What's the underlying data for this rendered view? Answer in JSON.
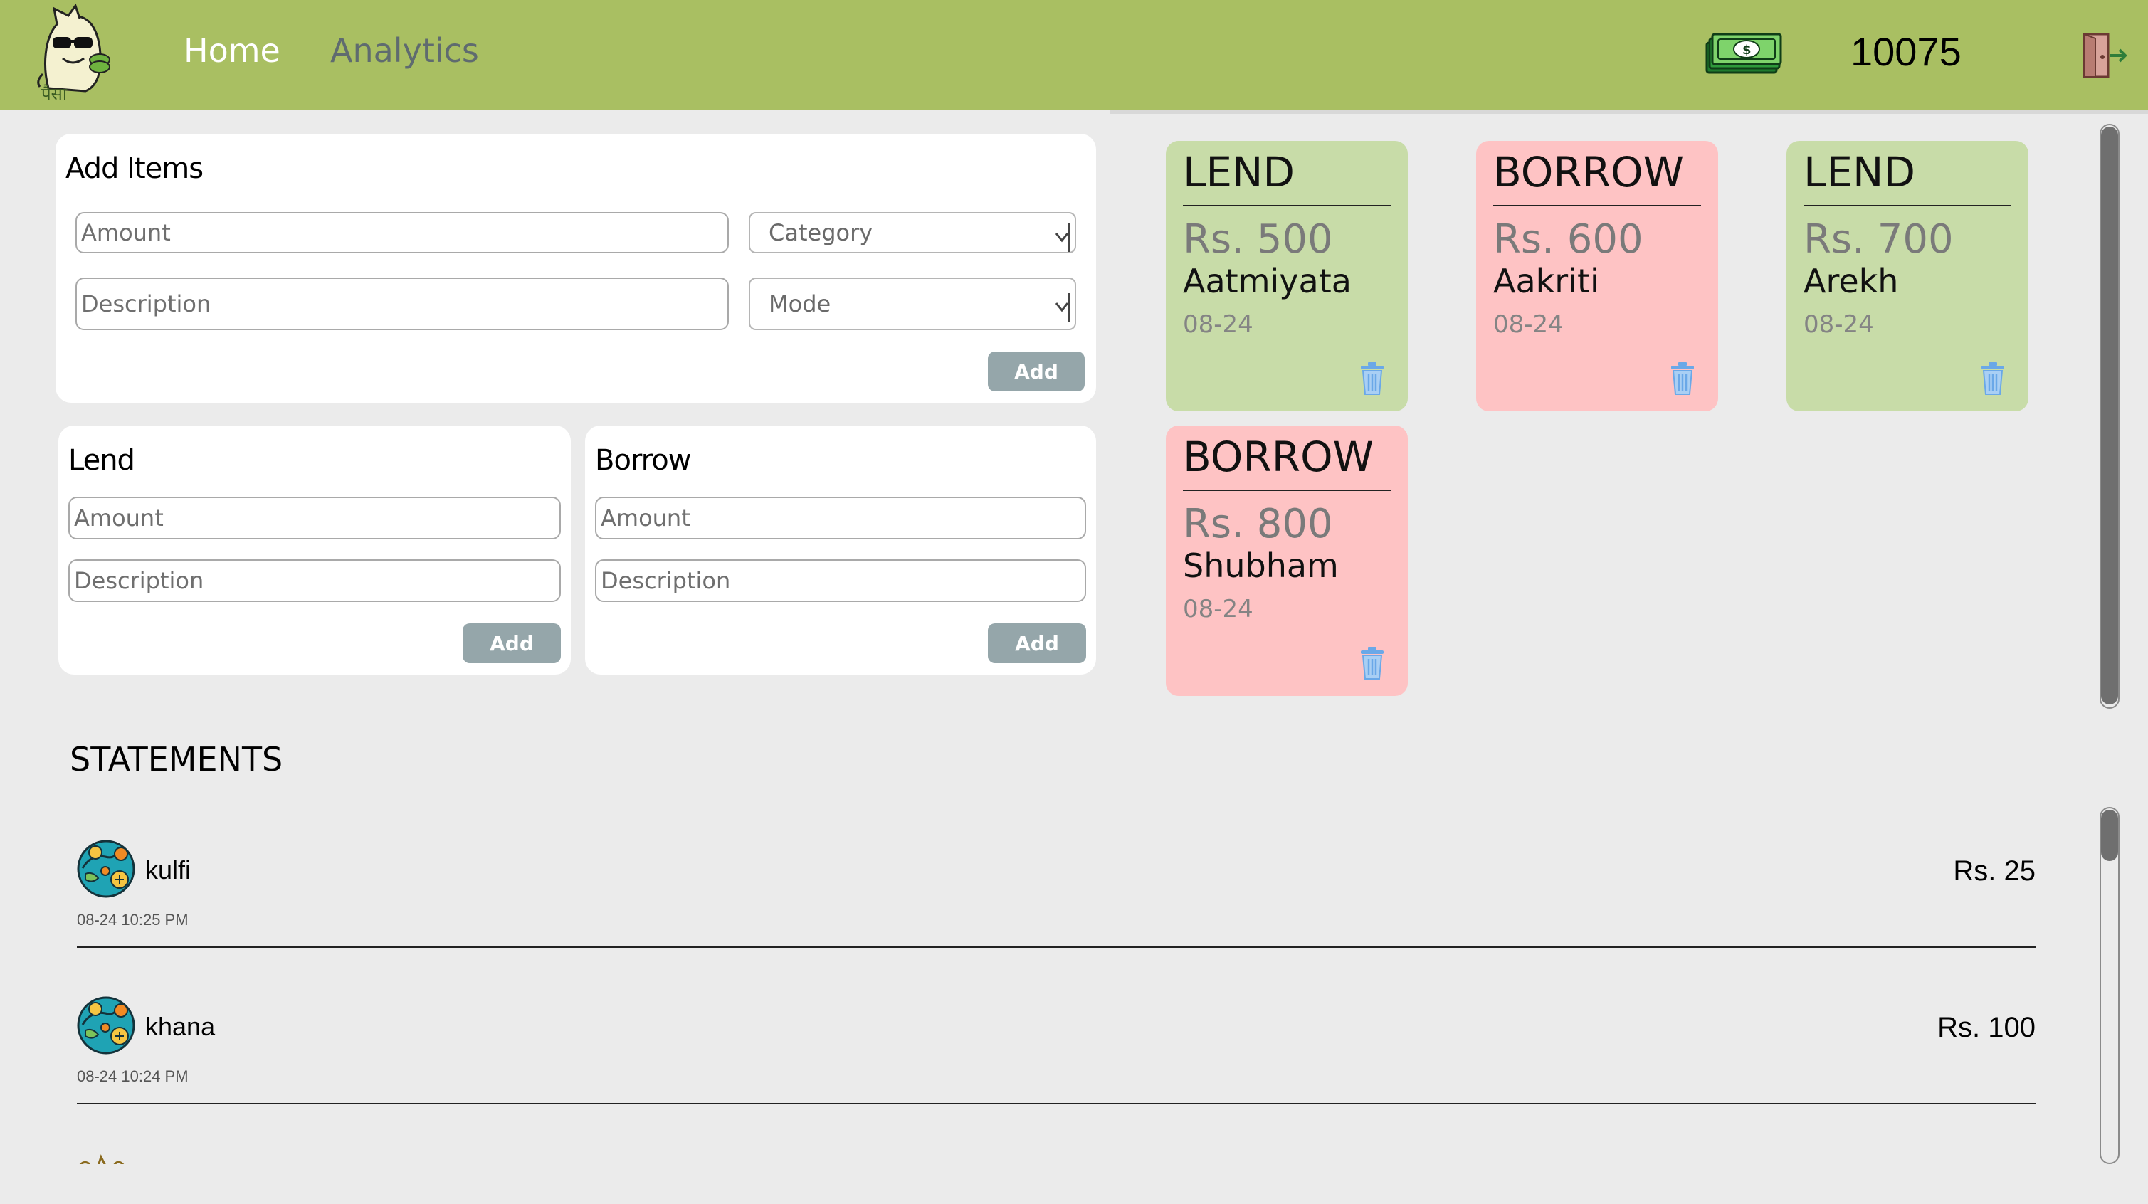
{
  "nav": {
    "home": "Home",
    "analytics": "Analytics",
    "logo_icon": "mascot-logo-icon",
    "logo_text": "पैसा",
    "money_icon": "cash-icon",
    "logout_icon": "logout-icon"
  },
  "balance": "10075",
  "add_items": {
    "title": "Add Items",
    "amount_placeholder": "Amount",
    "category_label": "Category",
    "description_placeholder": "Description",
    "mode_label": "Mode",
    "add_label": "Add"
  },
  "lend_form": {
    "title": "Lend",
    "amount_placeholder": "Amount",
    "description_placeholder": "Description",
    "add_label": "Add"
  },
  "borrow_form": {
    "title": "Borrow",
    "amount_placeholder": "Amount",
    "description_placeholder": "Description",
    "add_label": "Add"
  },
  "cards": [
    {
      "type": "LEND",
      "amount": "Rs. 500",
      "name": "Aatmiyata",
      "date": "08-24",
      "color": "#c8dca8"
    },
    {
      "type": "BORROW",
      "amount": "Rs. 600",
      "name": "Aakriti",
      "date": "08-24",
      "color": "#fec3c4"
    },
    {
      "type": "LEND",
      "amount": "Rs. 700",
      "name": "Arekh",
      "date": "08-24",
      "color": "#c8dca8"
    },
    {
      "type": "BORROW",
      "amount": "Rs. 800",
      "name": "Shubham",
      "date": "08-24",
      "color": "#fec3c4"
    }
  ],
  "statements": {
    "title": "STATEMENTS",
    "items": [
      {
        "name": "kulfi",
        "amount": "Rs. 25",
        "time": "08-24 10:25 PM",
        "icon": "food-category-icon"
      },
      {
        "name": "khana",
        "amount": "Rs. 100",
        "time": "08-24 10:24 PM",
        "icon": "food-category-icon"
      }
    ]
  },
  "colors": {
    "navbar": "#a9bf62",
    "lend_card": "#c8dca8",
    "borrow_card": "#fec3c4",
    "button": "#95a6aa",
    "background": "#ebebeb"
  }
}
